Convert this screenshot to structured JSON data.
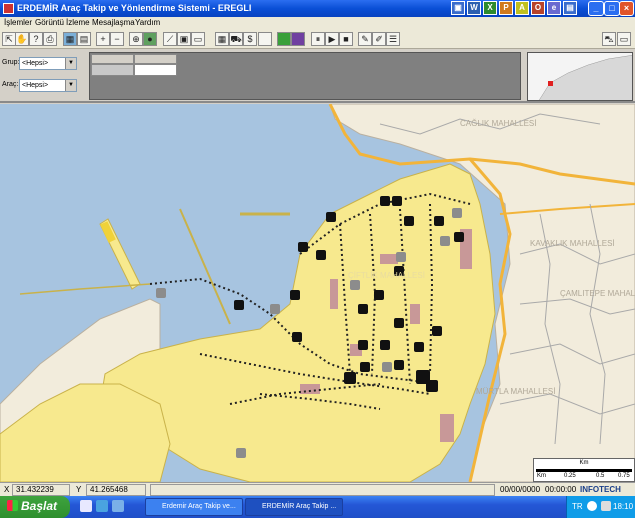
{
  "window": {
    "title": "ERDEMİR Araç Takip ve Yönlendirme Sistemi  - EREGLI"
  },
  "menu": [
    "İşlemler",
    "Görüntü",
    "İzleme",
    "Mesajlaşma",
    "Yardım"
  ],
  "filters": {
    "grup_label": "Grup:",
    "grup_value": "<Hepsi>",
    "arac_label": "Araç:",
    "arac_value": "<Hepsi>"
  },
  "map_labels": {
    "north_district": "CAĞLIK MAHALLESİ",
    "kavaklik": "KAVAKLIK MAHALLESİ",
    "camlitepe": "ÇAMLITEPE MAHALLESİ",
    "ciftlik": "ÇİFTLİK MAHALLESİ",
    "south": "MÜRTLA MAHALLESİ"
  },
  "scale": {
    "title": "Km",
    "labels": [
      "Km",
      "0.25",
      "0.5",
      "0.75"
    ]
  },
  "status": {
    "x_label": "X",
    "x_value": "31.432239",
    "y_label": "Y",
    "y_value": "41.265468",
    "date": "00/00/0000",
    "time": "00:00:00",
    "brand": "INFOTECH"
  },
  "taskbar": {
    "start": "Başlat",
    "task1": "Erdemir Araç Takip ve...",
    "task2": "ERDEMİR Araç Takip ...",
    "lang": "TR",
    "clock": "18:10"
  },
  "colors": {
    "land": "#f2ecdc",
    "plant": "#f7e98e",
    "sea": "#a7c4e0",
    "road_main": "#f2b43a"
  }
}
